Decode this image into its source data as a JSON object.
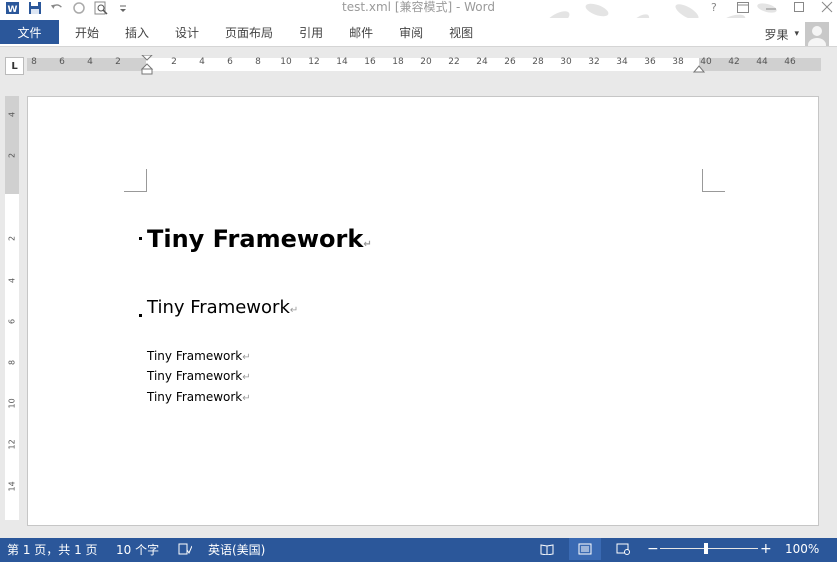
{
  "window": {
    "title": "test.xml [兼容模式] - Word"
  },
  "ribbon": {
    "file_tab": "文件",
    "tabs": [
      "开始",
      "插入",
      "设计",
      "页面布局",
      "引用",
      "邮件",
      "审阅",
      "视图"
    ],
    "user_name": "罗果",
    "user_dropdown": "▾"
  },
  "ruler": {
    "tab_selector": "L",
    "h_labels": [
      "8",
      "6",
      "4",
      "2",
      "2",
      "4",
      "6",
      "8",
      "10",
      "12",
      "14",
      "16",
      "18",
      "20",
      "22",
      "24",
      "26",
      "28",
      "30",
      "32",
      "34",
      "36",
      "38",
      "40",
      "42",
      "44",
      "46"
    ],
    "v_labels": [
      "4",
      "2",
      "2",
      "4",
      "6",
      "8",
      "10",
      "12",
      "14"
    ]
  },
  "document": {
    "heading1": "Tiny Framework",
    "heading2": "Tiny Framework",
    "body_lines": [
      "Tiny Framework",
      "Tiny Framework",
      "Tiny Framework"
    ],
    "paragraph_mark": "↵"
  },
  "statusbar": {
    "page_info": "第 1 页，共 1 页",
    "word_count": "10 个字",
    "language": "英语(美国)",
    "zoom_minus": "−",
    "zoom_plus": "+",
    "zoom_level": "100%"
  },
  "icons": {
    "word_app": "word-logo-icon",
    "save": "save-icon",
    "undo": "undo-icon",
    "redo": "redo-icon",
    "print_preview": "print-preview-icon",
    "customize": "customize-qat-icon"
  },
  "colors": {
    "accent": "#2b579a"
  },
  "zoom": {
    "slider_value": 0.47
  }
}
